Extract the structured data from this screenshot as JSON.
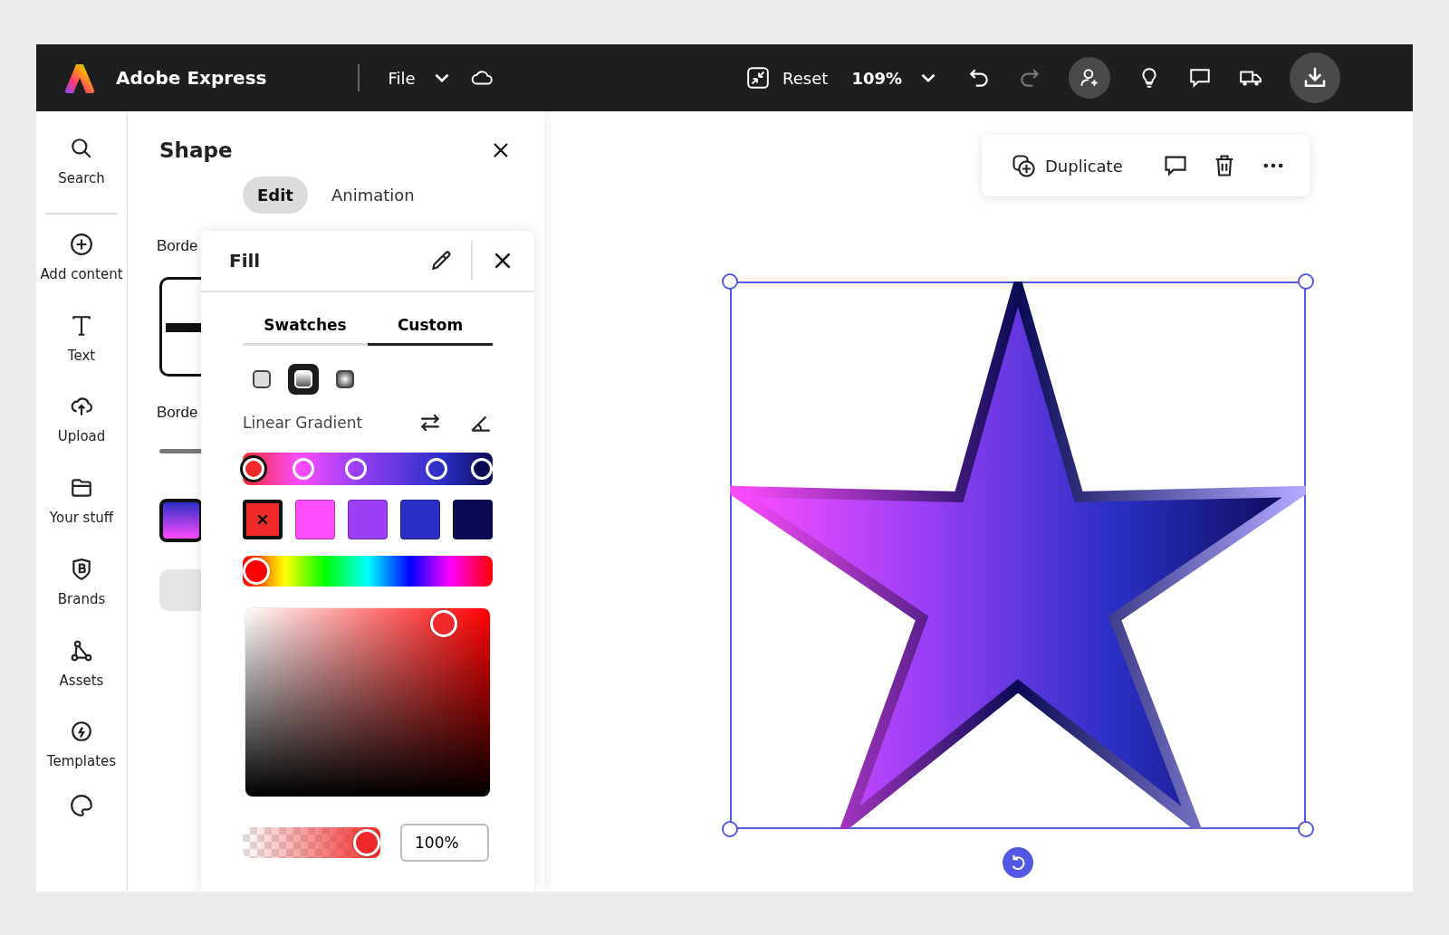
{
  "topbar": {
    "app_name": "Adobe Express",
    "file_menu": "File",
    "reset": "Reset",
    "zoom": "109%"
  },
  "rail": {
    "items": [
      {
        "kind": "search",
        "label": "Search"
      },
      {
        "kind": "add",
        "label": "Add content"
      },
      {
        "kind": "text",
        "label": "Text"
      },
      {
        "kind": "upload",
        "label": "Upload"
      },
      {
        "kind": "folder",
        "label": "Your stuff"
      },
      {
        "kind": "brand",
        "label": "Brands"
      },
      {
        "kind": "assets",
        "label": "Assets"
      },
      {
        "kind": "templates",
        "label": "Templates"
      }
    ]
  },
  "shape_panel": {
    "title": "Shape",
    "tabs": [
      {
        "label": "Edit",
        "selected": true
      },
      {
        "label": "Animation",
        "selected": false
      }
    ],
    "section_1": "Borde",
    "section_2": "Borde"
  },
  "fill": {
    "title": "Fill",
    "tabs": [
      {
        "label": "Swatches",
        "selected": false
      },
      {
        "label": "Custom",
        "selected": true
      }
    ],
    "fill_types": [
      {
        "kind": "solid",
        "selected": false
      },
      {
        "kind": "linear",
        "selected": true
      },
      {
        "kind": "radial",
        "selected": false
      }
    ],
    "gradient_type": "Linear Gradient",
    "stops": [
      {
        "color": "#f02a2a",
        "level": 0,
        "selected": true
      },
      {
        "color": "#ff4dff",
        "level": 0.22,
        "selected": false
      },
      {
        "color": "#9a3ff5",
        "level": 0.45,
        "selected": false
      },
      {
        "color": "#2b2fc6",
        "level": 0.8,
        "selected": false
      },
      {
        "color": "#0b0b55",
        "level": 1,
        "selected": false
      }
    ],
    "hue": {
      "level": 0
    },
    "picker": {
      "level": 0.85
    },
    "opacity": {
      "level": 1,
      "reading": "100%"
    }
  },
  "canvas": {
    "toolbar": {
      "duplicate": "Duplicate"
    }
  }
}
